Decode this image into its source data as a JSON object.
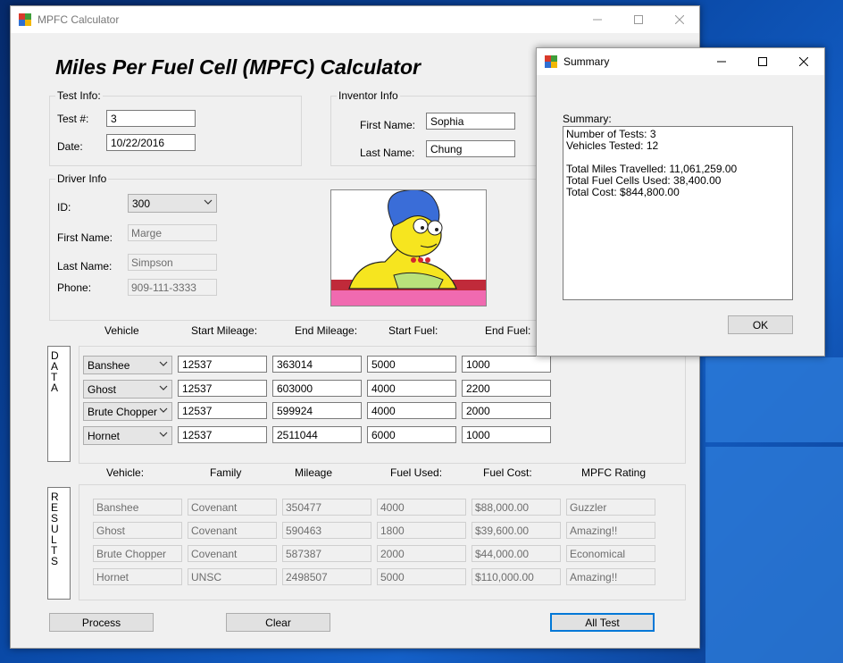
{
  "desktop": {
    "accent": "#1460c8"
  },
  "main_window": {
    "title": "MPFC Calculator",
    "heading": "Miles Per Fuel Cell (MPFC) Calculator",
    "test_info": {
      "group_title": "Test Info:",
      "test_num_label": "Test #:",
      "test_num_value": "3",
      "date_label": "Date:",
      "date_value": "10/22/2016"
    },
    "inventor_info": {
      "group_title": "Inventor Info",
      "first_name_label": "First Name:",
      "first_name_value": "Sophia",
      "last_name_label": "Last Name:",
      "last_name_value": "Chung"
    },
    "driver_info": {
      "group_title": "Driver Info",
      "id_label": "ID:",
      "id_value": "300",
      "first_name_label": "First Name:",
      "first_name_value": "Marge",
      "last_name_label": "Last Name:",
      "last_name_value": "Simpson",
      "phone_label": "Phone:",
      "phone_value": "909-111-3333"
    },
    "data_headers": [
      "Vehicle",
      "Start Mileage:",
      "End Mileage:",
      "Start Fuel:",
      "End Fuel:"
    ],
    "data_side_label": "DATA",
    "data_rows": [
      {
        "vehicle": "Banshee",
        "start_mileage": "12537",
        "end_mileage": "363014",
        "start_fuel": "5000",
        "end_fuel": "1000"
      },
      {
        "vehicle": "Ghost",
        "start_mileage": "12537",
        "end_mileage": "603000",
        "start_fuel": "4000",
        "end_fuel": "2200"
      },
      {
        "vehicle": "Brute Chopper",
        "start_mileage": "12537",
        "end_mileage": "599924",
        "start_fuel": "4000",
        "end_fuel": "2000"
      },
      {
        "vehicle": "Hornet",
        "start_mileage": "12537",
        "end_mileage": "2511044",
        "start_fuel": "6000",
        "end_fuel": "1000"
      }
    ],
    "results_headers": [
      "Vehicle:",
      "Family",
      "Mileage",
      "Fuel Used:",
      "Fuel Cost:",
      "MPFC Rating"
    ],
    "results_side_label": "RESULTS",
    "results_rows": [
      {
        "vehicle": "Banshee",
        "family": "Covenant",
        "mileage": "350477",
        "fuel_used": "4000",
        "fuel_cost": "$88,000.00",
        "rating": "Guzzler"
      },
      {
        "vehicle": "Ghost",
        "family": "Covenant",
        "mileage": "590463",
        "fuel_used": "1800",
        "fuel_cost": "$39,600.00",
        "rating": "Amazing!!"
      },
      {
        "vehicle": "Brute Chopper",
        "family": "Covenant",
        "mileage": "587387",
        "fuel_used": "2000",
        "fuel_cost": "$44,000.00",
        "rating": "Economical"
      },
      {
        "vehicle": "Hornet",
        "family": "UNSC",
        "mileage": "2498507",
        "fuel_used": "5000",
        "fuel_cost": "$110,000.00",
        "rating": "Amazing!!"
      }
    ],
    "buttons": {
      "process": "Process",
      "clear": "Clear",
      "all_test": "All Test"
    }
  },
  "summary_window": {
    "title": "Summary",
    "label": "Summary:",
    "lines": [
      "Number of Tests: 3",
      "Vehicles Tested: 12",
      "",
      "Total Miles Travelled: 11,061,259.00",
      "Total Fuel Cells Used: 38,400.00",
      "Total Cost: $844,800.00"
    ],
    "ok": "OK"
  }
}
